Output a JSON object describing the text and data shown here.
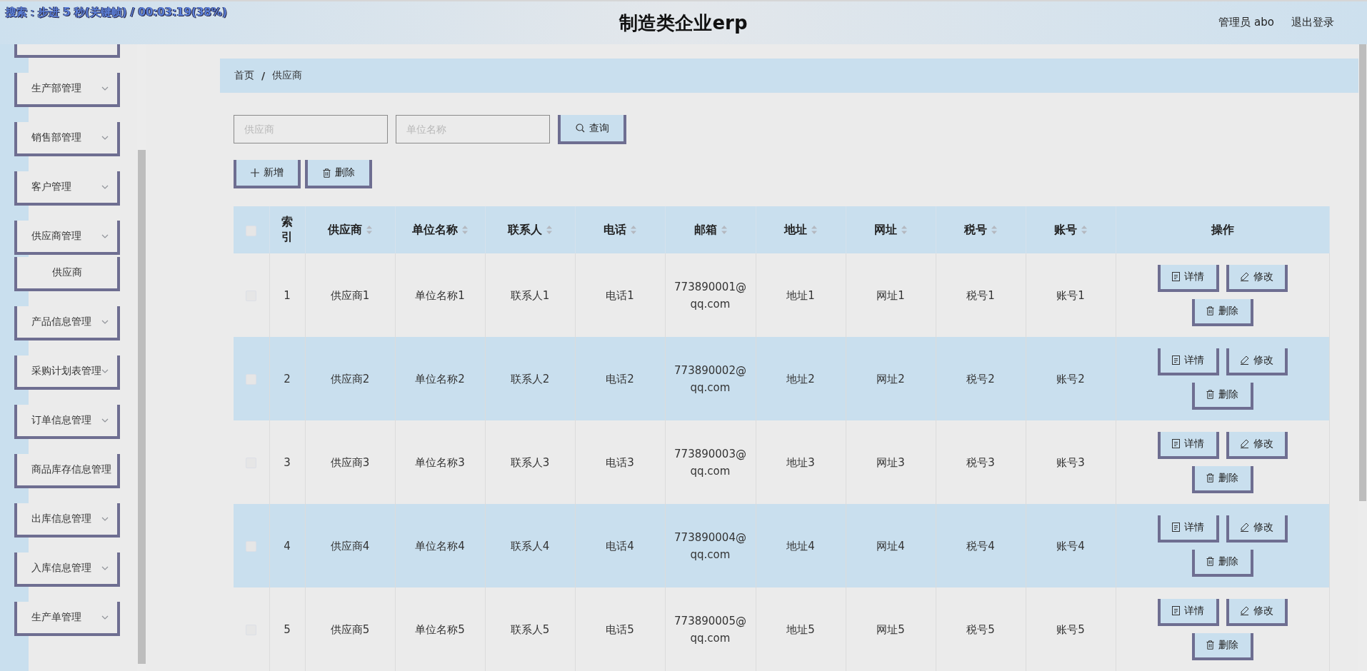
{
  "osd": "搜索：步进 5 秒(关键帧) / 00:03:19(38%)",
  "header": {
    "title": "制造类企业erp",
    "user": "管理员 abo",
    "logout": "退出登录"
  },
  "sidebar": {
    "items": [
      {
        "label": "生产部管理",
        "kind": "group"
      },
      {
        "label": "销售部管理",
        "kind": "group"
      },
      {
        "label": "客户管理",
        "kind": "group"
      },
      {
        "label": "供应商管理",
        "kind": "group",
        "children": [
          {
            "label": "供应商"
          }
        ]
      },
      {
        "label": "产品信息管理",
        "kind": "group"
      },
      {
        "label": "采购计划表管理",
        "kind": "group"
      },
      {
        "label": "订单信息管理",
        "kind": "group"
      },
      {
        "label": "商品库存信息管理",
        "kind": "link"
      },
      {
        "label": "出库信息管理",
        "kind": "group"
      },
      {
        "label": "入库信息管理",
        "kind": "group"
      },
      {
        "label": "生产单管理",
        "kind": "group"
      }
    ]
  },
  "breadcrumb": {
    "items": [
      "首页",
      "供应商"
    ],
    "separator": "/"
  },
  "search": {
    "fields": [
      {
        "placeholder": "供应商"
      },
      {
        "placeholder": "单位名称"
      }
    ],
    "button": "查询"
  },
  "toolbar": {
    "add": "新增",
    "delete": "删除"
  },
  "table": {
    "header_checked": false,
    "columns": [
      {
        "label": "索引",
        "sortable": false
      },
      {
        "label": "供应商",
        "sortable": true
      },
      {
        "label": "单位名称",
        "sortable": true
      },
      {
        "label": "联系人",
        "sortable": true
      },
      {
        "label": "电话",
        "sortable": true
      },
      {
        "label": "邮箱",
        "sortable": true
      },
      {
        "label": "地址",
        "sortable": true
      },
      {
        "label": "网址",
        "sortable": true
      },
      {
        "label": "税号",
        "sortable": true
      },
      {
        "label": "账号",
        "sortable": true
      },
      {
        "label": "操作",
        "sortable": false
      }
    ],
    "rows": [
      {
        "checked": false,
        "cells": [
          "1",
          "供应商1",
          "单位名称1",
          "联系人1",
          "电话1",
          "773890001@qq.com",
          "地址1",
          "网址1",
          "税号1",
          "账号1"
        ],
        "actions": [
          "详情",
          "修改",
          "删除"
        ]
      },
      {
        "checked": false,
        "cells": [
          "2",
          "供应商2",
          "单位名称2",
          "联系人2",
          "电话2",
          "773890002@qq.com",
          "地址2",
          "网址2",
          "税号2",
          "账号2"
        ],
        "actions": [
          "详情",
          "修改",
          "删除"
        ]
      },
      {
        "checked": false,
        "cells": [
          "3",
          "供应商3",
          "单位名称3",
          "联系人3",
          "电话3",
          "773890003@qq.com",
          "地址3",
          "网址3",
          "税号3",
          "账号3"
        ],
        "actions": [
          "详情",
          "修改",
          "删除"
        ]
      },
      {
        "checked": false,
        "cells": [
          "4",
          "供应商4",
          "单位名称4",
          "联系人4",
          "电话4",
          "773890004@qq.com",
          "地址4",
          "网址4",
          "税号4",
          "账号4"
        ],
        "actions": [
          "详情",
          "修改",
          "删除"
        ]
      },
      {
        "checked": false,
        "cells": [
          "5",
          "供应商5",
          "单位名称5",
          "联系人5",
          "电话5",
          "773890005@qq.com",
          "地址5",
          "网址5",
          "税号5",
          "账号5"
        ],
        "actions": [
          "详情",
          "修改",
          "删除"
        ]
      }
    ]
  }
}
